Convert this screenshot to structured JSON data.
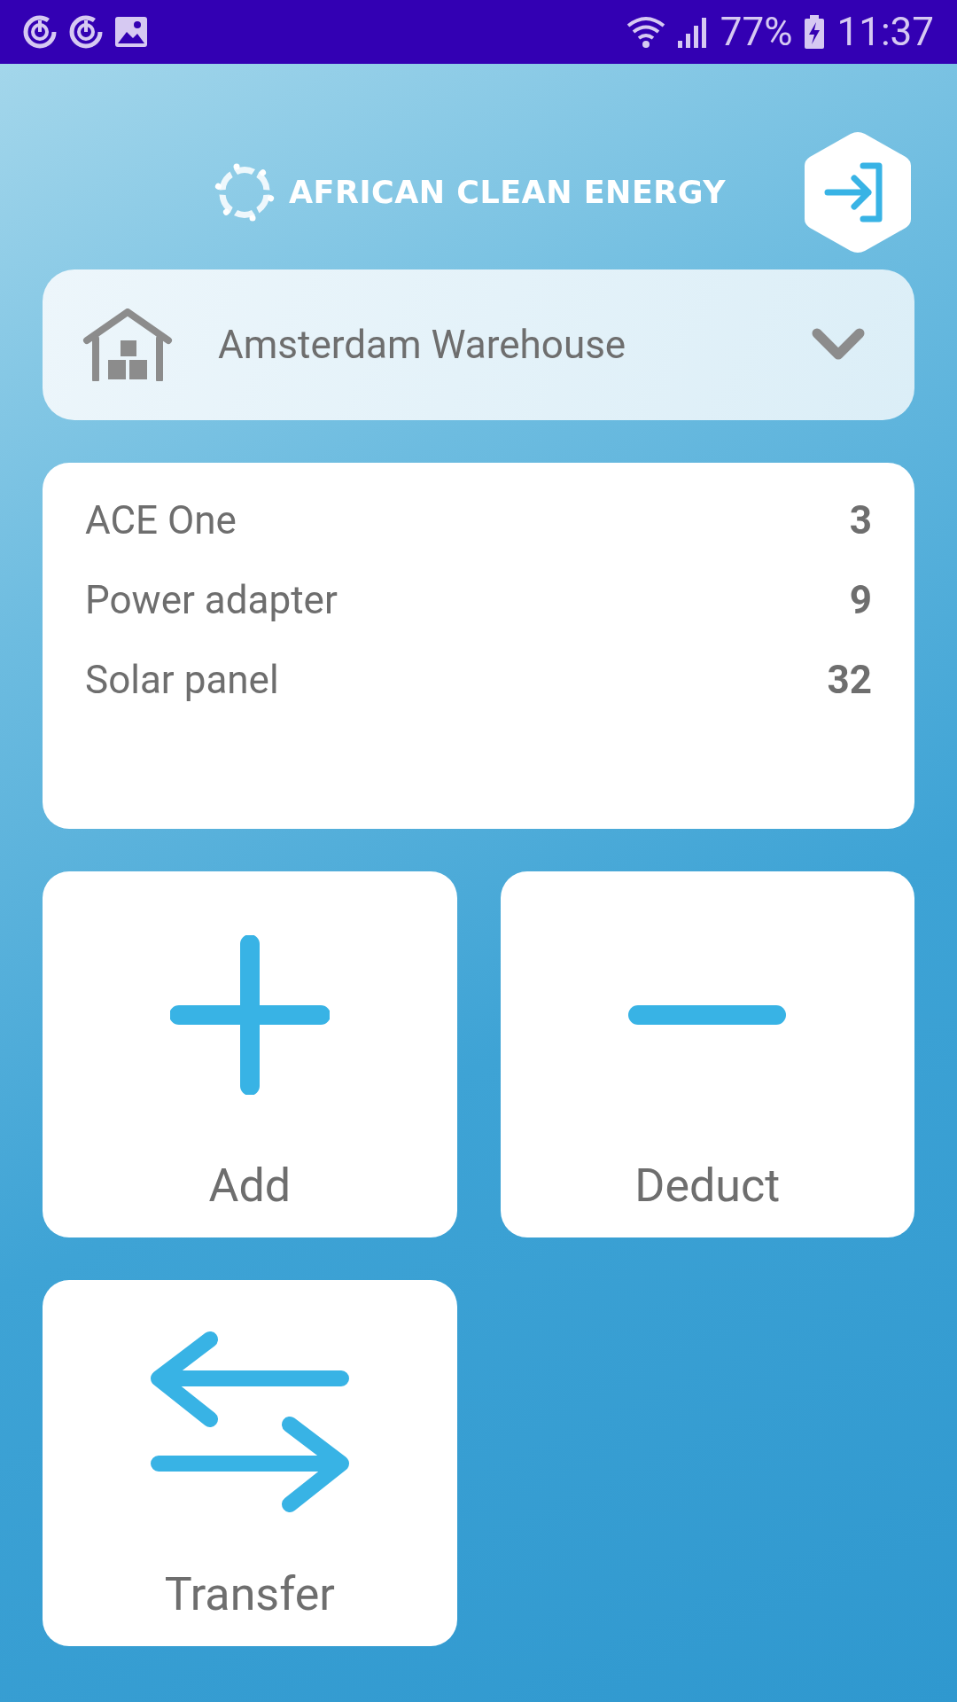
{
  "status_bar": {
    "battery": "77%",
    "time": "11:37"
  },
  "header": {
    "logo_text": "AFRICAN CLEAN ENERGY"
  },
  "location": {
    "value": "Amsterdam Warehouse"
  },
  "stock": [
    {
      "name": "ACE One",
      "count": "3"
    },
    {
      "name": "Power adapter",
      "count": "9"
    },
    {
      "name": "Solar panel",
      "count": "32"
    }
  ],
  "actions": [
    {
      "kind": "add",
      "label": "Add"
    },
    {
      "kind": "deduct",
      "label": "Deduct"
    },
    {
      "kind": "transfer",
      "label": "Transfer"
    }
  ]
}
